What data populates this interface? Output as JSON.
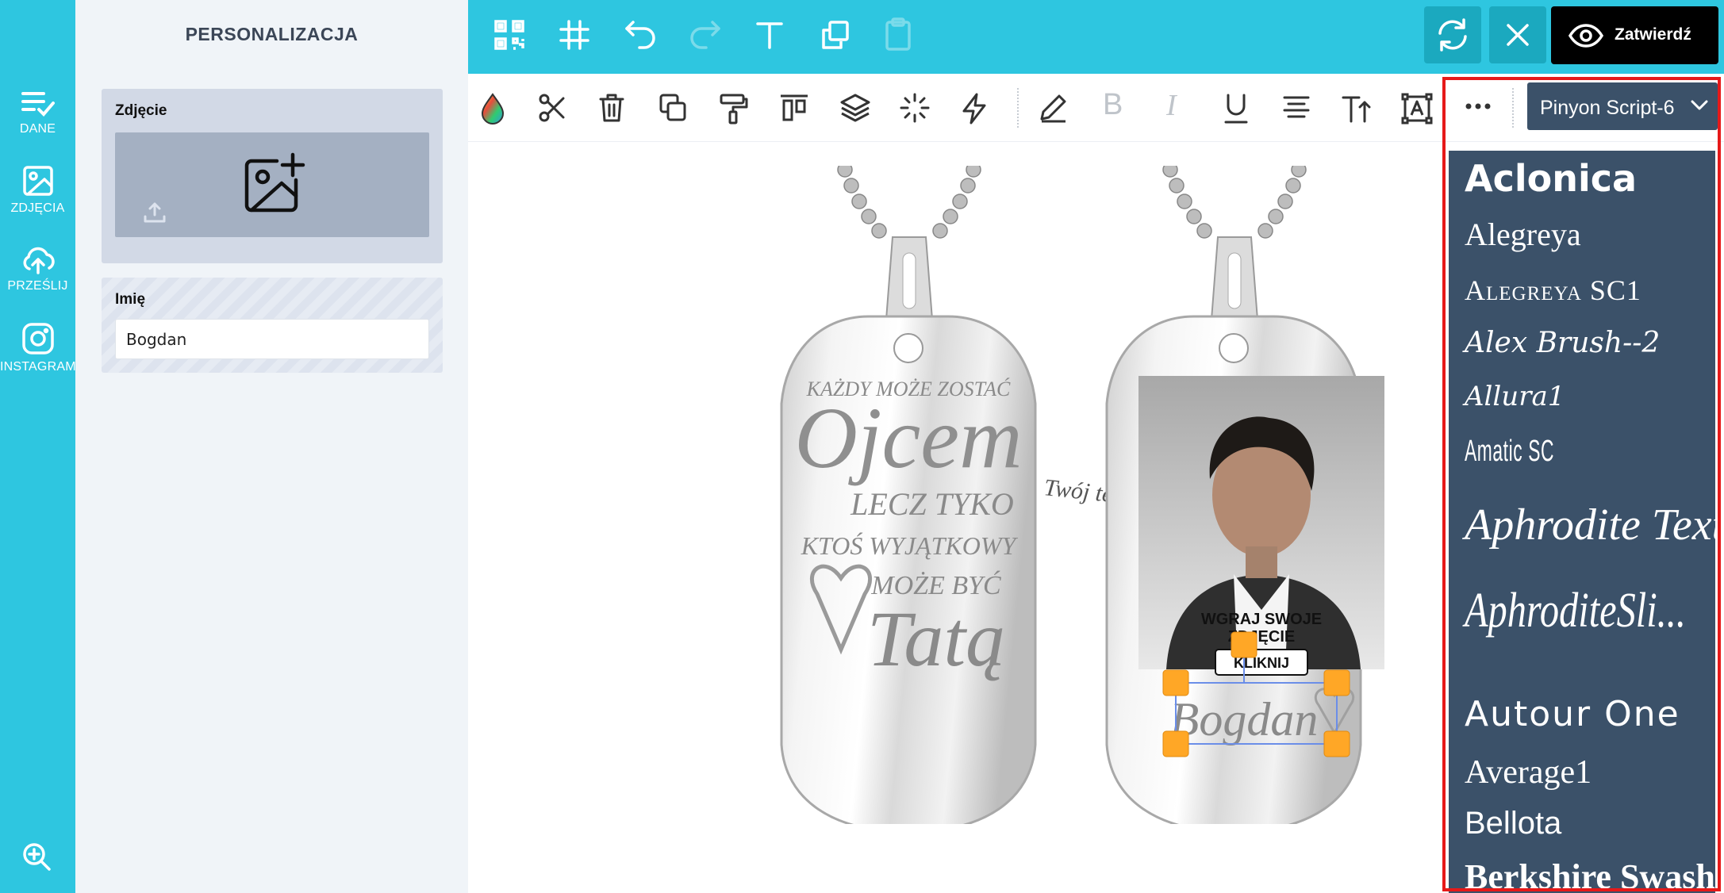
{
  "colors": {
    "accent": "#2ec6e0",
    "accent_dark": "#1ba9bf",
    "dropdown_bg": "#3b5169",
    "highlight": "#e61919",
    "handle": "#ffa726",
    "approve_bg": "#000000"
  },
  "rail": {
    "items": [
      {
        "label": "DANE",
        "icon": "list-check-icon"
      },
      {
        "label": "ZDJĘCIA",
        "icon": "image-icon"
      },
      {
        "label": "PRZEŚLIJ",
        "icon": "cloud-upload-icon"
      },
      {
        "label": "INSTAGRAM",
        "icon": "instagram-icon"
      }
    ],
    "zoom_icon": "zoom-in-icon"
  },
  "panel": {
    "title": "PERSONALIZACJA",
    "photo": {
      "label": "Zdjęcie"
    },
    "name": {
      "label": "Imię",
      "value": "Bogdan"
    }
  },
  "topbar": {
    "icons": [
      "qr-code-icon",
      "grid-hash-icon",
      "undo-icon",
      "redo-icon",
      "text-icon",
      "duplicate-icon",
      "clipboard-icon"
    ],
    "approve_label": "Zatwierdź"
  },
  "toolbar2": {
    "icons": [
      "color-drop-icon",
      "scissors-icon",
      "trash-icon",
      "copy-icon",
      "paint-roller-icon",
      "align-top-icon",
      "layers-icon",
      "sparkle-icon",
      "lightning-icon",
      "pencil-icon",
      "bold-icon",
      "italic-icon",
      "underline-icon",
      "align-center-icon",
      "text-size-icon",
      "text-box-icon",
      "more-icon"
    ],
    "bold_letter": "B",
    "italic_letter": "I",
    "font_selected": "Pinyon Script-6"
  },
  "canvas": {
    "tag1": {
      "line1": "KAŻDY MOŻE ZOSTAĆ",
      "line2": "Ojcem",
      "line3": "LECZ TYKO",
      "line4": "KTOŚ WYJĄTKOWY",
      "line5": "MOŻE BYĆ",
      "line6": "Tatą"
    },
    "floating_text": "Twój tekst",
    "tag2": {
      "photo_caption_1": "WGRAJ SWOJE",
      "photo_caption_2": "ZDJĘCIE",
      "click_button": "KLIKNIJ",
      "name_text": "Bogdan"
    }
  },
  "font_list": [
    "Aclonica",
    "Alegreya",
    "Alegreya SC1",
    "Alex Brush--2",
    "Allura1",
    "Amatic SC",
    "Aphrodite Text",
    "AphroditeSli...",
    "Autour One",
    "Average1",
    "Bellota",
    "Berkshire Swash"
  ]
}
